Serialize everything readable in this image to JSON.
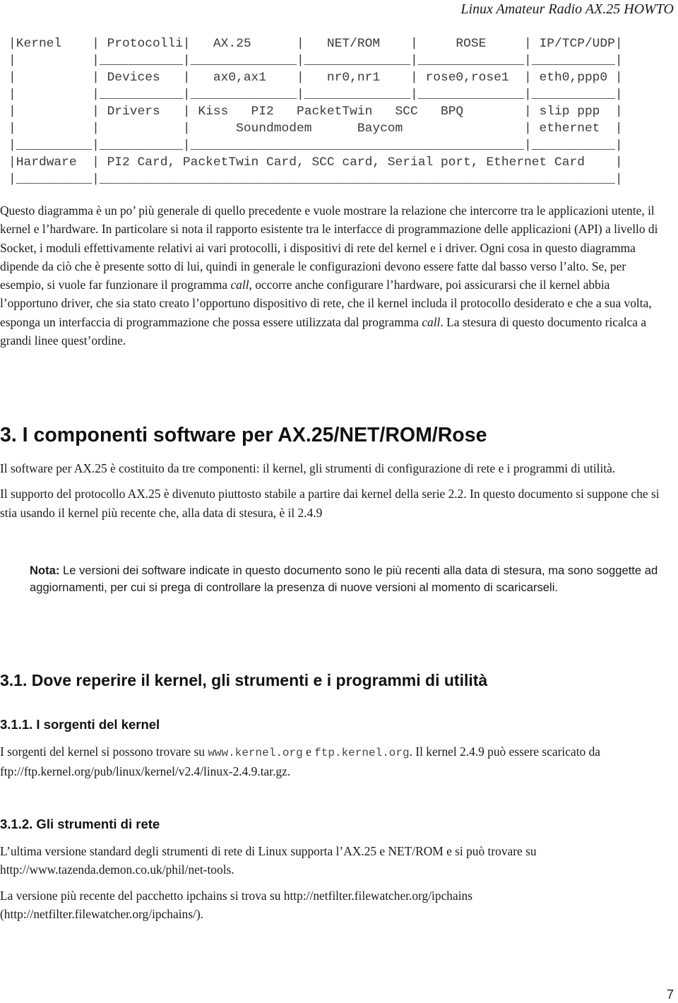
{
  "header": {
    "title": "Linux Amateur Radio AX.25 HOWTO"
  },
  "diagram": {
    "lines": [
      "|Kernel    | Protocolli|   AX.25      |   NET/ROM    |     ROSE     | IP/TCP/UDP|",
      "|          |___________|______________|______________|______________|___________|",
      "|          | Devices   |   ax0,ax1    |   nr0,nr1    | rose0,rose1  | eth0,ppp0 |",
      "|          |___________|______________|______________|______________|___________|",
      "|          | Drivers   | Kiss   PI2   PacketTwin   SCC   BPQ        | slip ppp  |",
      "|          |           |      Soundmodem      Baycom                | ethernet  |",
      "|__________|___________|____________________________________________|___________|",
      "|Hardware  | PI2 Card, PacketTwin Card, SCC card, Serial port, Ethernet Card    |",
      "|__________|____________________________________________________________________|"
    ]
  },
  "intro": {
    "p1_a": "Questo diagramma è un po’ più generale di quello precedente e vuole mostrare la relazione che intercorre tra le applicazioni utente, il kernel e l’hardware. In particolare si nota il rapporto esistente tra le interfacce di programmazione delle applicazioni (API) a livello di Socket, i moduli effettivamente relativi ai vari protocolli, i dispositivi di rete del kernel e i driver. Ogni cosa in questo diagramma dipende da ciò che è presente sotto di lui, quindi in generale le configurazioni devono essere fatte dal basso verso l’alto. Se, per esempio, si vuole far funzionare il programma ",
    "p1_em1": "call",
    "p1_b": ", occorre anche configurare l’hardware, poi assicurarsi che il kernel abbia l’opportuno driver, che sia stato creato l’opportuno dispositivo di rete, che il kernel includa il protocollo desiderato e che a sua volta, esponga un interfaccia di programmazione che possa essere utilizzata dal programma ",
    "p1_em2": "call",
    "p1_c": ". La stesura di questo documento ricalca a grandi linee quest’ordine."
  },
  "section3": {
    "title": "3. I componenti software per AX.25/NET/ROM/Rose",
    "p1": "Il software per AX.25 è costituito da tre componenti: il kernel, gli strumenti di configurazione di rete e i programmi di utilità.",
    "p2": "Il supporto del protocollo AX.25 è divenuto piuttosto stabile a partire dai kernel della serie 2.2. In questo documento si suppone che si stia usando il kernel più recente che, alla data di stesura, è il 2.4.9",
    "note_label": "Nota:",
    "note_text": " Le versioni dei software indicate in questo documento sono le più recenti alla data di stesura, ma sono soggette ad aggiornamenti, per cui si prega di controllare la presenza di nuove versioni al momento di scaricarseli."
  },
  "section3_1": {
    "title": "3.1. Dove reperire il kernel, gli strumenti e i programmi di utilità"
  },
  "section3_1_1": {
    "title": "3.1.1. I sorgenti del kernel",
    "p_a": "I sorgenti del kernel si possono trovare su ",
    "link1": "www.kernel.org",
    "p_b": " e ",
    "link2": "ftp.kernel.org",
    "p_c": ". Il kernel 2.4.9 può essere scaricato da ftp://ftp.kernel.org/pub/linux/kernel/v2.4/linux-2.4.9.tar.gz."
  },
  "section3_1_2": {
    "title": "3.1.2. Gli strumenti di rete",
    "p1": "L’ultima versione standard degli strumenti di rete di Linux supporta l’AX.25 e NET/ROM e si può trovare su http://www.tazenda.demon.co.uk/phil/net-tools.",
    "p2": "La versione più recente del pacchetto ipchains si trova su http://netfilter.filewatcher.org/ipchains (http://netfilter.filewatcher.org/ipchains/)."
  },
  "footer": {
    "page_number": "7"
  }
}
